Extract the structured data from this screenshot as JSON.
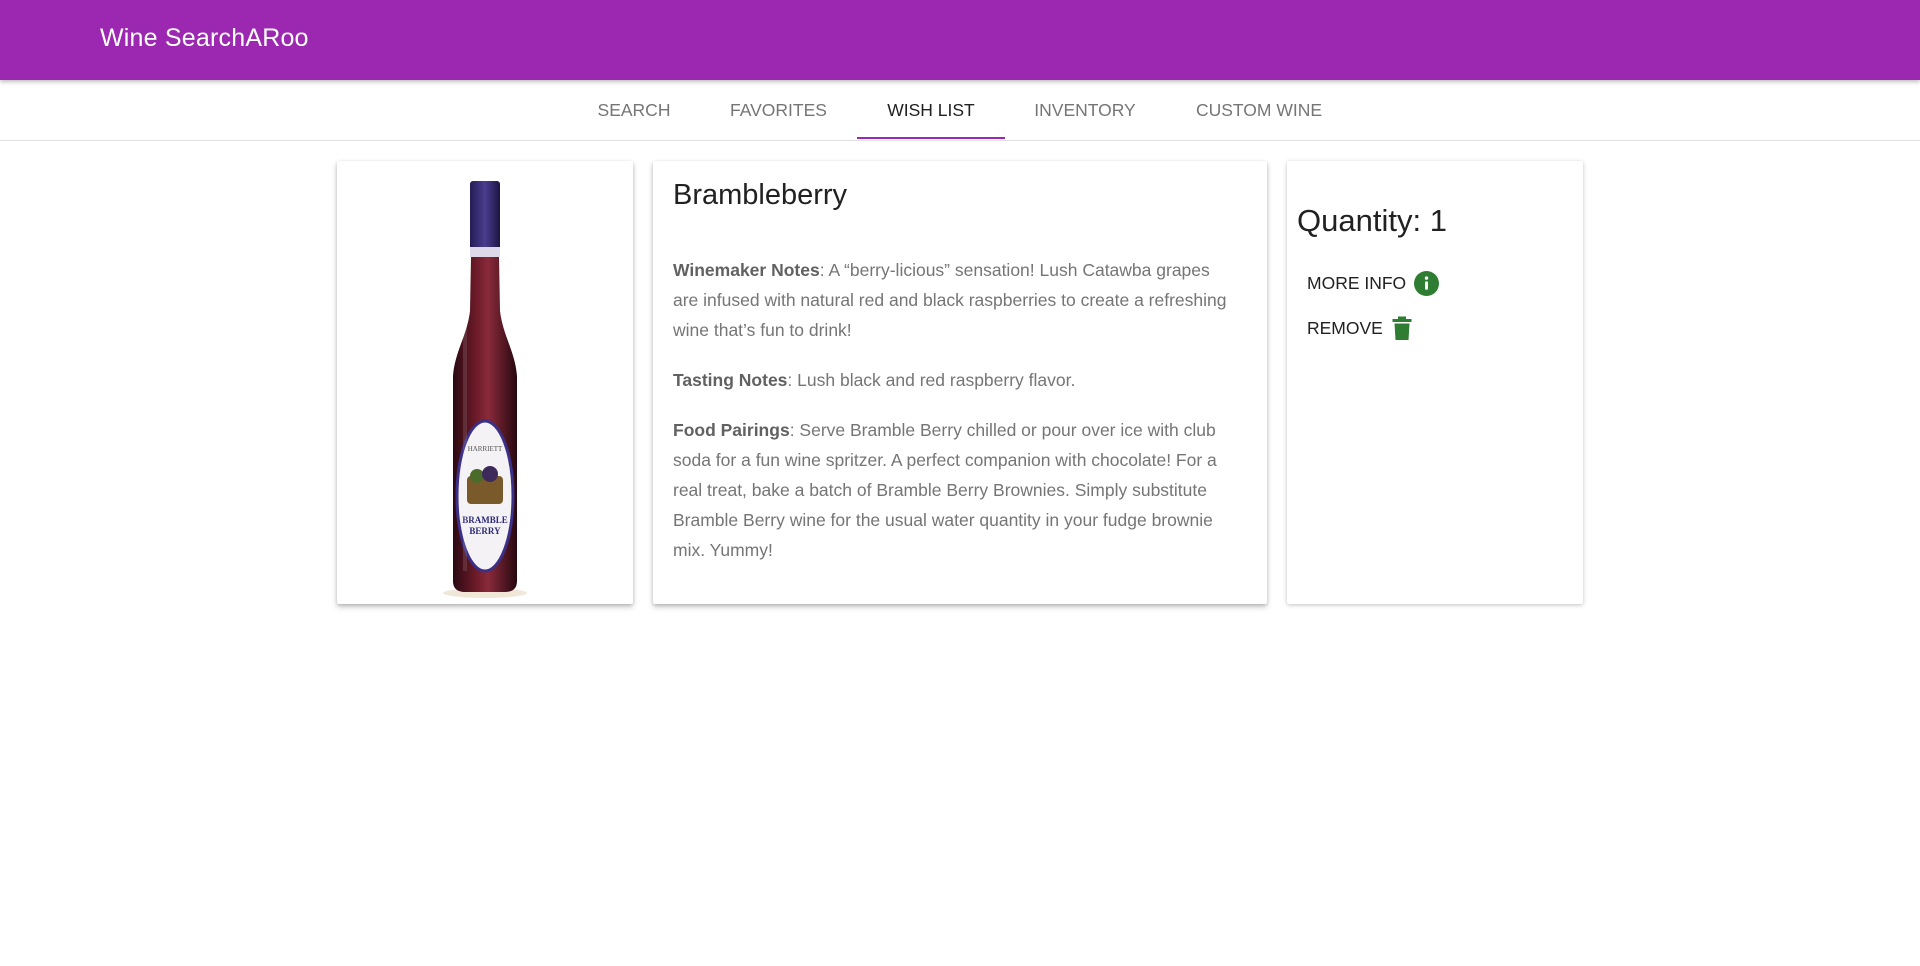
{
  "app": {
    "title": "Wine SearchARoo",
    "brand_color": "#9c27b0"
  },
  "tabs": [
    {
      "label": "SEARCH",
      "active": false
    },
    {
      "label": "FAVORITES",
      "active": false
    },
    {
      "label": "WISH LIST",
      "active": true
    },
    {
      "label": "INVENTORY",
      "active": false
    },
    {
      "label": "CUSTOM WINE",
      "active": false
    }
  ],
  "wine": {
    "name": "Brambleberry",
    "bottle_label_lines": [
      "HARRIETT",
      "BRAMBLE",
      "BERRY"
    ],
    "winemaker_notes_label": "Winemaker Notes",
    "winemaker_notes": ": A “berry-licious” sensation! Lush Catawba grapes are infused with natural red and black raspberries to create a refreshing wine that’s fun to drink!",
    "tasting_notes_label": "Tasting Notes",
    "tasting_notes": ": Lush black and red raspberry flavor.",
    "food_pairings_label": "Food Pairings",
    "food_pairings": ": Serve Bramble Berry chilled or pour over ice with club soda for a fun wine spritzer. A perfect companion with chocolate! For a real treat, bake a batch of Bramble Berry Brownies. Simply substitute Bramble Berry wine for the usual water quantity in your fudge brownie mix. Yummy!"
  },
  "actions": {
    "quantity_label": "Quantity:",
    "quantity_value": "1",
    "more_info_label": "MORE INFO",
    "more_info_icon": "info-circle-icon",
    "remove_label": "REMOVE",
    "remove_icon": "trash-icon",
    "icon_color": "#2e7d32"
  }
}
